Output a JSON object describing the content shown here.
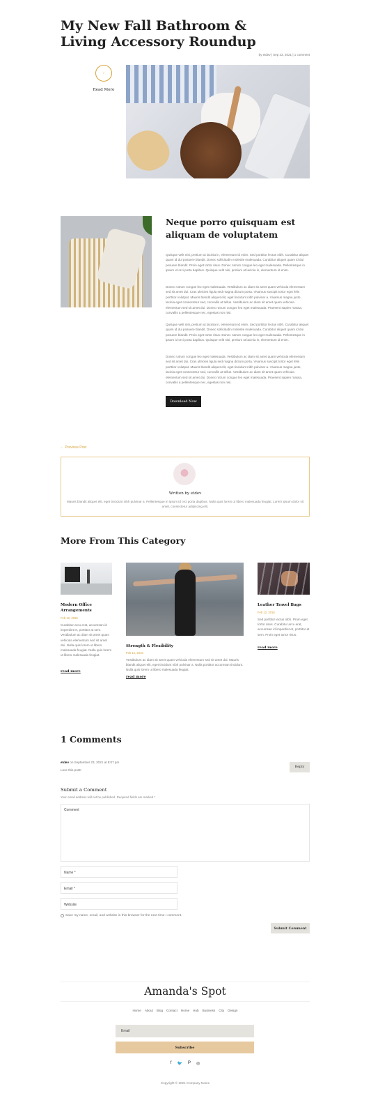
{
  "post": {
    "title": "My New Fall Bathroom & Living Accessory Roundup",
    "meta": "by etdev | Sep 23, 2021 | 1 comment",
    "read_more_arrow": "›",
    "read_more": "Read More"
  },
  "section": {
    "heading": "Neque porro quisquam est aliquam de voluptatem",
    "paragraphs": [
      "Quisque velit nisi, pretium ut lacinia in, elementum id enim. Sed porttitor lectus nibh. Curabitur aliquet quam id dui posuere blandit. Donec sollicitudin molestie malesuada. Curabitur aliquet quam id dui posuere blandit. Proin eget tortor risus. Donec rutrum congue leo eget malesuada. Pellentesque in ipsum id orci porta dapibus. Quisque velit nisi, pretium ut lacinia in, elementum id enim.",
      "Donec rutrum congue leo eget malesuada. Vestibulum ac diam sit amet quam vehicula elementum sed sit amet dui. Cras ultricies ligula sed magna dictum porta. Vivamus suscipit tortor eget felis porttitor volutpat. Mauris blandit aliquet elit, eget tincidunt nibh pulvinar a. Vivamus magna justo, lacinia eget consectetur sed, convallis at tellus. Vestibulum ac diam sit amet quam vehicula elementum sed sit amet dui. Donec rutrum congue leo eget malesuada. Praesent sapien massa, convallis a pellentesque nec, egestas non nisi.",
      "Quisque velit nisi, pretium ut lacinia in, elementum id enim. Sed porttitor lectus nibh. Curabitur aliquet quam id dui posuere blandit. Donec sollicitudin molestie malesuada. Curabitur aliquet quam id dui posuere blandit. Proin eget tortor risus. Donec rutrum congue leo eget malesuada. Pellentesque in ipsum id orci porta dapibus. Quisque velit nisi, pretium ut lacinia in, elementum id enim.",
      "Donec rutrum congue leo eget malesuada. Vestibulum ac diam sit amet quam vehicula elementum sed sit amet dui. Cras ultricies ligula sed magna dictum porta. Vivamus suscipit tortor eget felis porttitor volutpat. Mauris blandit aliquet elit, eget tincidunt nibh pulvinar a. Vivamus magna justo, lacinia eget consectetur sed, convallis at tellus. Vestibulum ac diam sit amet quam vehicula elementum sed sit amet dui. Donec rutrum congue leo eget malesuada. Praesent sapien massa, convallis a pellentesque nec, egestas non nisi."
    ],
    "button": "Download Now"
  },
  "nav": {
    "previous": "← Previous Post"
  },
  "author": {
    "written_by": "Written by etdev",
    "bio": "Mauris blandit aliquet elit, eget tincidunt nibh pulvinar a. Pellentesque in ipsum id orci porta dapibus. Nulla quis lorem ut libero malesuada feugiat. Lorem ipsum dolor sit amet, consectetur adipiscing elit."
  },
  "category": {
    "heading": "More From This Category",
    "cards": [
      {
        "title": "Modern Office Arrangements",
        "date": "Feb 12, 2016",
        "excerpt": "Curabitur arcu erat, accumsan id imperdiet et, porttitor at sem. Vestibulum ac diam sit amet quam vehicula elementum sed sit amet dui. Nulla quis lorem ut libero malesuada feugiat. Nulla quis lorem ut libero malesuada feugiat.",
        "more": "read more"
      },
      {
        "title": "Strength & Flexibility",
        "date": "Feb 12, 2016",
        "excerpt": "Vestibulum ac diam sit amet quam vehicula elementum sed sit amet dui. Mauris blandit aliquet elit, eget tincidunt nibh pulvinar a. Nulla porttitor accumsan tincidunt. Nulla quis lorem ut libero malesuada feugiat.",
        "more": "read more"
      },
      {
        "title": "Leather Travel Bags",
        "date": "Feb 12, 2016",
        "excerpt": "Sed porttitor lectus nibh. Proin eget tortor risus. Curabitur arcu erat, accumsan id imperdiet et, porttitor at sem. Proin eget tortor risus.",
        "more": "read more"
      }
    ]
  },
  "comments": {
    "heading": "1 Comments",
    "author": "etdev",
    "date": " on September 23, 2021 at 8:07 pm",
    "text": "Love this post!",
    "reply": "Reply"
  },
  "form": {
    "heading": "Submit a Comment",
    "required_note": "Your email address will not be published. Required fields are marked *",
    "comment_label": "Comment",
    "name_label": "Name *",
    "email_label": "Email *",
    "website_label": "Website",
    "save_label": "Save my name, email, and website in this browser for the next time I comment.",
    "submit": "Submit Comment"
  },
  "footer": {
    "brand": "Amanda's Spot",
    "links": [
      "Home",
      "About",
      "Blog",
      "Contact",
      "Home",
      "Hub",
      "Business",
      "City",
      "Design"
    ],
    "email_placeholder": "Email",
    "subscribe": "Subscribe",
    "social": [
      "f",
      "🐦",
      "P",
      "◎"
    ],
    "copyright": "Copyright © 2021 Company Name"
  },
  "colors": {
    "accent": "#d6a33a",
    "dark": "#1c1c1c",
    "subscribe": "#e7c9a0"
  }
}
